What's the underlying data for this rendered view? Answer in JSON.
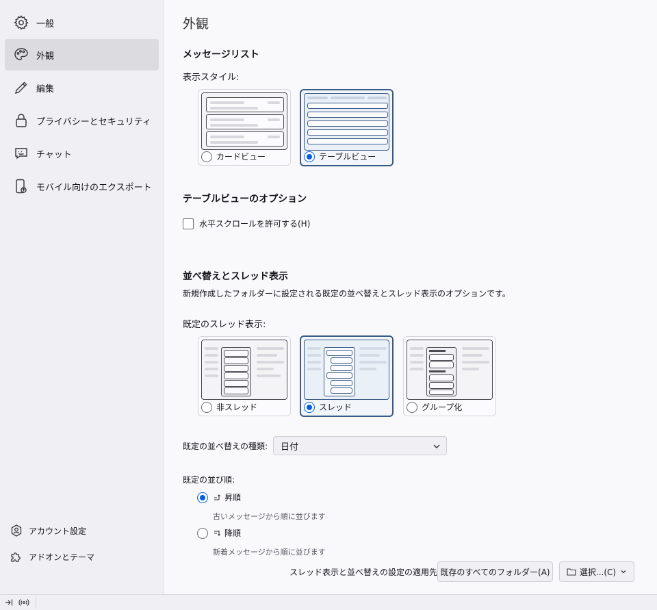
{
  "sidebar": {
    "items": [
      {
        "label": "一般",
        "icon": "gear-icon"
      },
      {
        "label": "外観",
        "icon": "palette-icon"
      },
      {
        "label": "編集",
        "icon": "pencil-icon"
      },
      {
        "label": "プライバシーとセキュリティ",
        "icon": "lock-icon"
      },
      {
        "label": "チャット",
        "icon": "chat-icon"
      },
      {
        "label": "モバイル向けのエクスポート",
        "icon": "mobile-export-icon"
      }
    ],
    "active": "外観",
    "bottom": {
      "account_settings": "アカウント設定",
      "addons_themes": "アドオンとテーマ"
    }
  },
  "page": {
    "title": "外観"
  },
  "message_list": {
    "heading": "メッセージリスト",
    "style_label": "表示スタイル:",
    "card_view": "カードビュー",
    "table_view": "テーブルビュー",
    "selected": "テーブルビュー"
  },
  "table_options": {
    "heading": "テーブルビューのオプション",
    "horizontal_scroll": "水平スクロールを許可する(H)",
    "horizontal_scroll_checked": false
  },
  "sort_thread": {
    "heading": "並べ替えとスレッド表示",
    "description": "新規作成したフォルダーに設定される既定の並べ替えとスレッド表示のオプションです。",
    "thread_label": "既定のスレッド表示:",
    "options": {
      "unthreaded": "非スレッド",
      "threaded": "スレッド",
      "grouped": "グループ化"
    },
    "selected": "スレッド",
    "sort_type_label": "既定の並べ替えの種類:",
    "sort_type_value": "日付",
    "order_label": "既定の並び順:",
    "ascending": "昇順",
    "ascending_desc": "古いメッセージから順に並びます",
    "descending": "降順",
    "descending_desc": "新着メッセージから順に並びます",
    "order_selected": "昇順",
    "apply_label": "スレッド表示と並べ替えの設定の適用先:",
    "apply_all_button": "既存のすべてのフォルダー(A)",
    "choose_button": "選択...(C)"
  },
  "statusbar": {
    "icons": [
      "sidebar-toggle-icon",
      "connection-icon"
    ]
  }
}
